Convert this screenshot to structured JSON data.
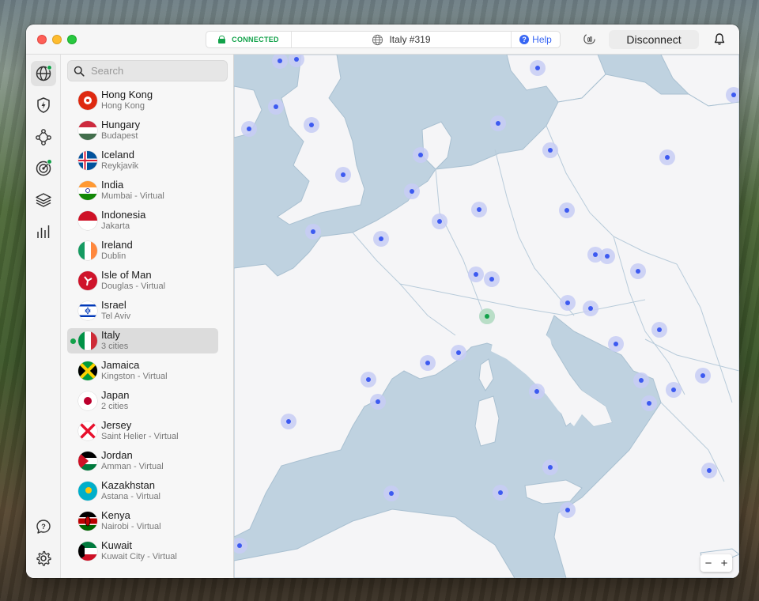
{
  "titlebar": {
    "status": "CONNECTED",
    "server": "Italy #319",
    "help_label": "Help",
    "disconnect_label": "Disconnect"
  },
  "rail": {
    "icons": [
      "globe-icon",
      "bolt-shield-icon",
      "meshnet-icon",
      "radar-icon",
      "layers-icon",
      "stats-icon",
      "support-icon",
      "settings-icon"
    ]
  },
  "search": {
    "placeholder": "Search"
  },
  "countries": [
    {
      "name": "Hong Kong",
      "sub": "Hong Kong"
    },
    {
      "name": "Hungary",
      "sub": "Budapest"
    },
    {
      "name": "Iceland",
      "sub": "Reykjavik"
    },
    {
      "name": "India",
      "sub": "Mumbai - Virtual"
    },
    {
      "name": "Indonesia",
      "sub": "Jakarta"
    },
    {
      "name": "Ireland",
      "sub": "Dublin"
    },
    {
      "name": "Isle of Man",
      "sub": "Douglas - Virtual"
    },
    {
      "name": "Israel",
      "sub": "Tel Aviv"
    },
    {
      "name": "Italy",
      "sub": "3 cities"
    },
    {
      "name": "Jamaica",
      "sub": "Kingston - Virtual"
    },
    {
      "name": "Japan",
      "sub": "2 cities"
    },
    {
      "name": "Jersey",
      "sub": "Saint Helier - Virtual"
    },
    {
      "name": "Jordan",
      "sub": "Amman - Virtual"
    },
    {
      "name": "Kazakhstan",
      "sub": "Astana - Virtual"
    },
    {
      "name": "Kenya",
      "sub": "Nairobi - Virtual"
    },
    {
      "name": "Kuwait",
      "sub": "Kuwait City - Virtual"
    }
  ],
  "selected_country": "Italy",
  "colors": {
    "connected": "#12a24a",
    "accent": "#3766f4",
    "water": "#bfd2e0",
    "land": "#f5f5f7",
    "server_dot": "#3d5af1"
  },
  "zoom": {
    "minus": "−",
    "plus": "+"
  }
}
